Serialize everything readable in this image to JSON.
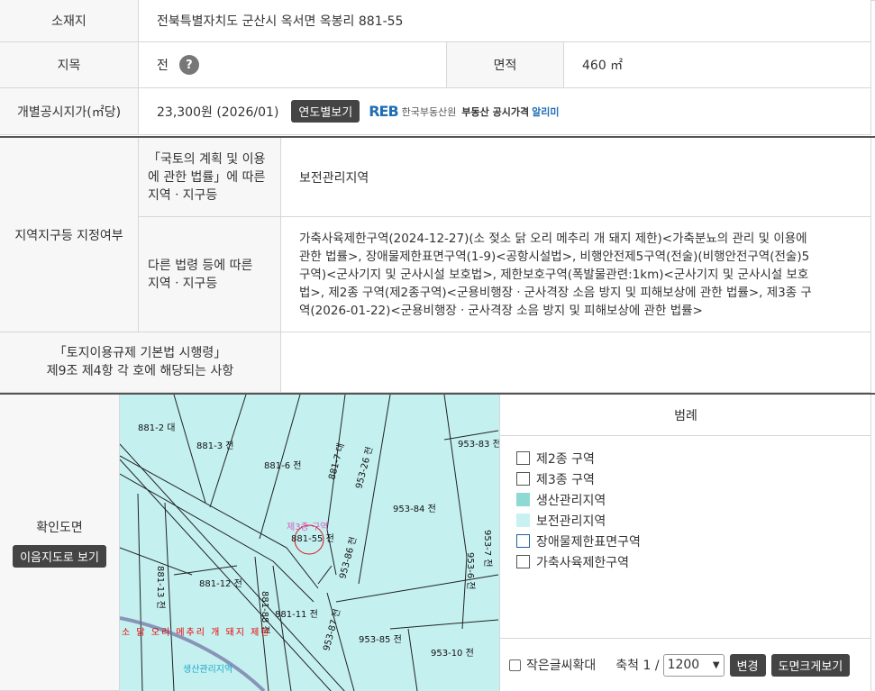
{
  "location": {
    "label": "소재지",
    "value": "전북특별자치도 군산시 옥서면 옥봉리 881-55"
  },
  "land_category": {
    "label": "지목",
    "value": "전",
    "help": "?"
  },
  "area": {
    "label": "면적",
    "value": "460 ㎡"
  },
  "price": {
    "label": "개별공시지가(㎡당)",
    "value": "23,300원 (2026/01)",
    "yearly_button": "연도별보기",
    "reb_logo": "REB",
    "reb_org": "한국부동산원",
    "reb_service": "부동산 공시가격",
    "reb_alimi": "알리미"
  },
  "zoning": {
    "label": "지역지구등 지정여부",
    "national_label_1": "「국토의 계획 및 이용",
    "national_label_2": "에 관한 법률」에 따른",
    "national_label_3": "지역ㆍ지구등",
    "national_value": "보전관리지역",
    "other_label_1": "다른 법령 등에 따른",
    "other_label_2": "지역ㆍ지구등",
    "other_lines": [
      "가축사육제한구역(2024-12-27)(소 젖소 닭 오리 메추리 개 돼지 제한)<가축분뇨의 관리 및 이용에",
      "관한 법률>, 장애물제한표면구역(1-9)<공항시설법>, 비행안전제5구역(전술)(비행안전구역(전술)5",
      "구역)<군사기지 및 군사시설 보호법>, 제한보호구역(폭발물관련:1km)<군사기지 및 군사시설 보호",
      "법>, 제2종 구역(제2종구역)<군용비행장ㆍ군사격장 소음 방지 및 피해보상에 관한 법률>, 제3종 구",
      "역(2026-01-22)<군용비행장ㆍ군사격장 소음 방지 및 피해보상에 관한 법률>"
    ]
  },
  "enforcement": {
    "label_1": "「토지이용규제 기본법 시행령」",
    "label_2": "제9조 제4항 각 호에 해당되는 사항",
    "value": ""
  },
  "map_section": {
    "label": "확인도면",
    "map_button": "이음지도로 보기",
    "parcels": [
      "881-2 대",
      "881-3 전",
      "881-6 전",
      "881-7 대",
      "953-26 전",
      "953-83 전",
      "953-84 전",
      "881-55 전",
      "953-86 전",
      "953-6 전",
      "953-7 전",
      "881-13 전",
      "881-12 전",
      "881-88 전",
      "881-11 전",
      "953-87 전",
      "953-85 전",
      "953-10 전"
    ],
    "overlay_zone": "제3종 구역",
    "overlay_restrict": "소 닭 오리 메추리 개 돼지 제한",
    "overlay_conservation": "생산관리지역"
  },
  "legend": {
    "title": "범례",
    "items": [
      {
        "label": "제2종 구역",
        "color": "#ffffff",
        "border": "#555555"
      },
      {
        "label": "제3종 구역",
        "color": "#ffffff",
        "border": "#555555"
      },
      {
        "label": "생산관리지역",
        "color": "#8fd9d5",
        "border": "#8fd9d5"
      },
      {
        "label": "보전관리지역",
        "color": "#c8f2f2",
        "border": "#c8f2f2"
      },
      {
        "label": "장애물제한표면구역",
        "color": "#ffffff",
        "border": "#1f5fa0"
      },
      {
        "label": "가축사육제한구역",
        "color": "#ffffff",
        "border": "#555555"
      }
    ]
  },
  "controls": {
    "small_text_label": "작은글씨확대",
    "scale_label": "축척 1 /",
    "scale_value": "1200",
    "change_button": "변경",
    "enlarge_button": "도면크게보기"
  }
}
